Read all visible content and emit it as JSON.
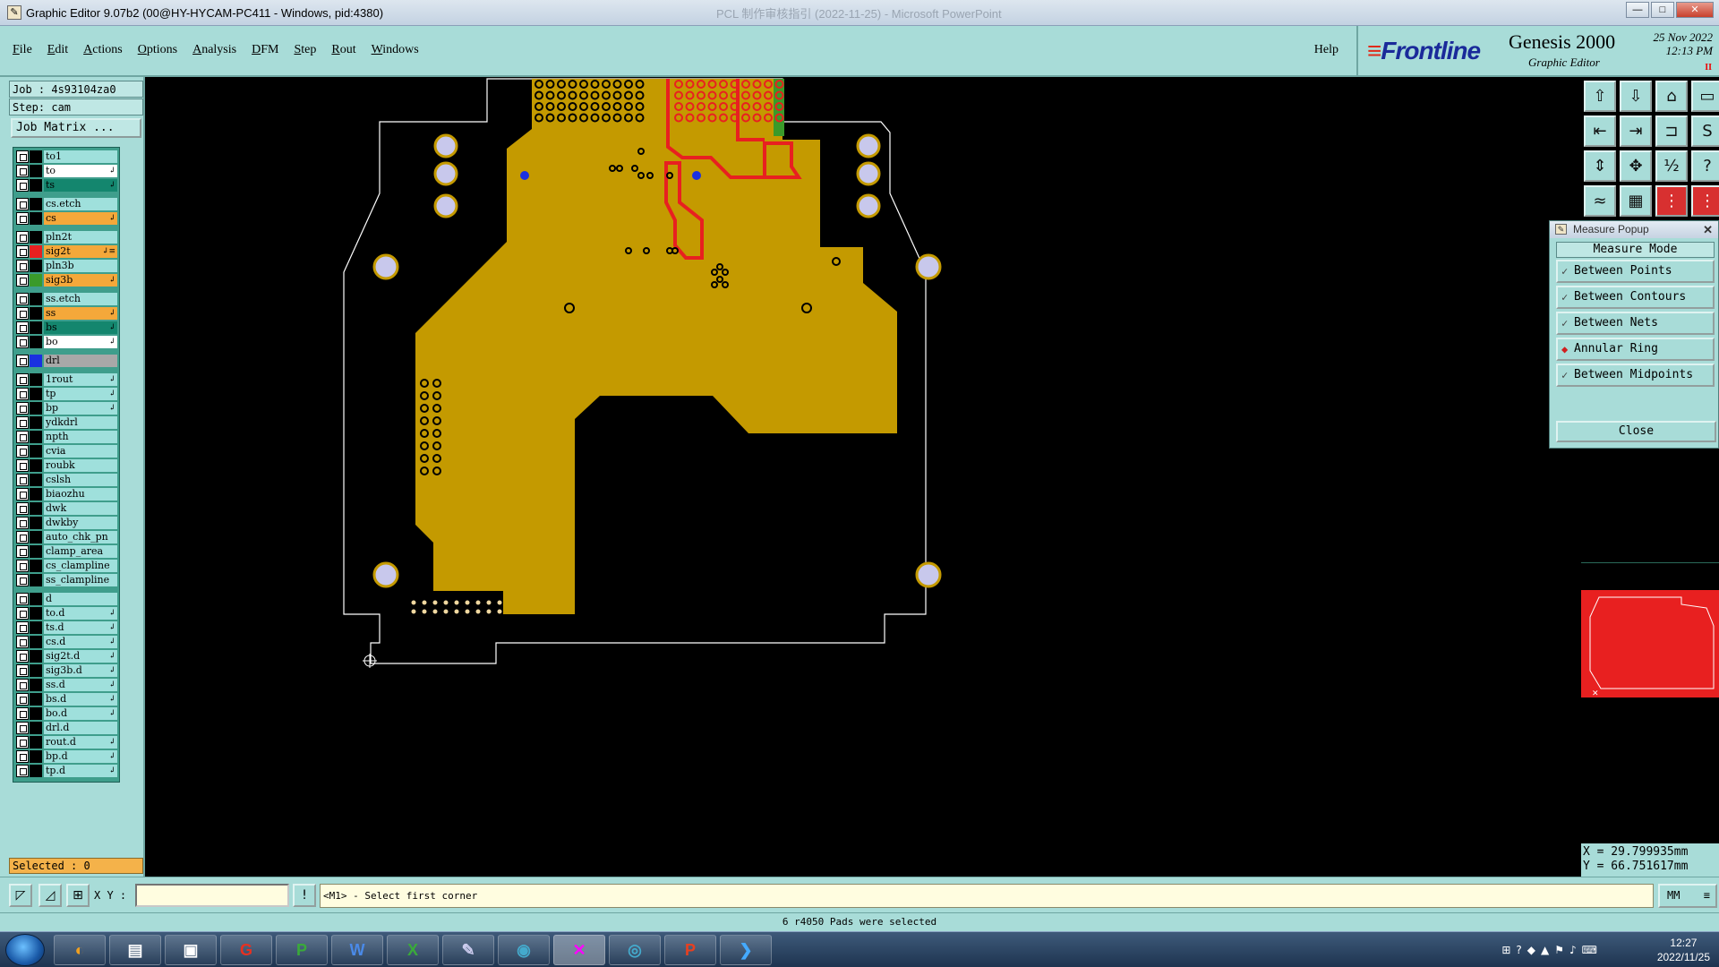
{
  "window": {
    "title": "Graphic Editor 9.07b2 (00@HY-HYCAM-PC411 - Windows, pid:4380)",
    "ghost_title": "PCL 制作审核指引 (2022-11-25) - Microsoft PowerPoint",
    "min_label": "—",
    "max_label": "□",
    "close_label": "✕"
  },
  "menu": {
    "items": [
      "File",
      "Edit",
      "Actions",
      "Options",
      "Analysis",
      "DFM",
      "Step",
      "Rout",
      "Windows"
    ],
    "help": "Help"
  },
  "brand": {
    "logo": "Frontline",
    "product": "Genesis 2000",
    "subtitle": "Graphic Editor",
    "date": "25 Nov 2022",
    "time": "12:13 PM",
    "pause": "II"
  },
  "job": {
    "job_label": "Job : 4s93104za0",
    "step_label": "Step: cam",
    "matrix_button": "Job Matrix ..."
  },
  "layers": [
    {
      "name": "to1",
      "color": "#000000",
      "bg": "#9fe0dc",
      "arrow": ""
    },
    {
      "name": "to",
      "color": "#000000",
      "bg": "#ffffff",
      "arrow": "↲"
    },
    {
      "name": "ts",
      "color": "#000000",
      "bg": "#14866e",
      "arrow": "↲"
    },
    {
      "name": "cs.etch",
      "color": "#000000",
      "bg": "#9fe0dc",
      "arrow": ""
    },
    {
      "name": "cs",
      "color": "#000000",
      "bg": "#f4a83a",
      "arrow": "↲"
    },
    {
      "name": "pln2t",
      "color": "#000000",
      "bg": "#9fe0dc",
      "arrow": ""
    },
    {
      "name": "sig2t",
      "color": "#e82020",
      "bg": "#f4a83a",
      "arrow": "↲≡"
    },
    {
      "name": "pln3b",
      "color": "#000000",
      "bg": "#9fe0dc",
      "arrow": ""
    },
    {
      "name": "sig3b",
      "color": "#3a9a2a",
      "bg": "#f4a83a",
      "arrow": "↲"
    },
    {
      "name": "ss.etch",
      "color": "#000000",
      "bg": "#9fe0dc",
      "arrow": ""
    },
    {
      "name": "ss",
      "color": "#000000",
      "bg": "#f4a83a",
      "arrow": "↲"
    },
    {
      "name": "bs",
      "color": "#000000",
      "bg": "#14866e",
      "arrow": "↲"
    },
    {
      "name": "bo",
      "color": "#000000",
      "bg": "#ffffff",
      "arrow": "↲"
    },
    {
      "name": "drl",
      "color": "#1a30e0",
      "bg": "#a8a8a8",
      "arrow": ""
    },
    {
      "name": "1rout",
      "color": "#000000",
      "bg": "#9fe0dc",
      "arrow": "↲"
    },
    {
      "name": "tp",
      "color": "#000000",
      "bg": "#9fe0dc",
      "arrow": "↲"
    },
    {
      "name": "bp",
      "color": "#000000",
      "bg": "#9fe0dc",
      "arrow": "↲"
    },
    {
      "name": "ydkdrl",
      "color": "#000000",
      "bg": "#9fe0dc",
      "arrow": ""
    },
    {
      "name": "npth",
      "color": "#000000",
      "bg": "#9fe0dc",
      "arrow": ""
    },
    {
      "name": "cvia",
      "color": "#000000",
      "bg": "#9fe0dc",
      "arrow": ""
    },
    {
      "name": "roubk",
      "color": "#000000",
      "bg": "#9fe0dc",
      "arrow": ""
    },
    {
      "name": "cslsh",
      "color": "#000000",
      "bg": "#9fe0dc",
      "arrow": ""
    },
    {
      "name": "biaozhu",
      "color": "#000000",
      "bg": "#9fe0dc",
      "arrow": ""
    },
    {
      "name": "dwk",
      "color": "#000000",
      "bg": "#9fe0dc",
      "arrow": ""
    },
    {
      "name": "dwkby",
      "color": "#000000",
      "bg": "#9fe0dc",
      "arrow": ""
    },
    {
      "name": "auto_chk_pn",
      "color": "#000000",
      "bg": "#9fe0dc",
      "arrow": ""
    },
    {
      "name": "clamp_area",
      "color": "#000000",
      "bg": "#9fe0dc",
      "arrow": ""
    },
    {
      "name": "cs_clampline",
      "color": "#000000",
      "bg": "#9fe0dc",
      "arrow": ""
    },
    {
      "name": "ss_clampline",
      "color": "#000000",
      "bg": "#9fe0dc",
      "arrow": ""
    },
    {
      "name": "d",
      "color": "#000000",
      "bg": "#9fe0dc",
      "arrow": ""
    },
    {
      "name": "to.d",
      "color": "#000000",
      "bg": "#9fe0dc",
      "arrow": "↲"
    },
    {
      "name": "ts.d",
      "color": "#000000",
      "bg": "#9fe0dc",
      "arrow": "↲"
    },
    {
      "name": "cs.d",
      "color": "#000000",
      "bg": "#9fe0dc",
      "arrow": "↲"
    },
    {
      "name": "sig2t.d",
      "color": "#000000",
      "bg": "#9fe0dc",
      "arrow": "↲"
    },
    {
      "name": "sig3b.d",
      "color": "#000000",
      "bg": "#9fe0dc",
      "arrow": "↲"
    },
    {
      "name": "ss.d",
      "color": "#000000",
      "bg": "#9fe0dc",
      "arrow": "↲"
    },
    {
      "name": "bs.d",
      "color": "#000000",
      "bg": "#9fe0dc",
      "arrow": "↲"
    },
    {
      "name": "bo.d",
      "color": "#000000",
      "bg": "#9fe0dc",
      "arrow": "↲"
    },
    {
      "name": "drl.d",
      "color": "#000000",
      "bg": "#9fe0dc",
      "arrow": ""
    },
    {
      "name": "rout.d",
      "color": "#000000",
      "bg": "#9fe0dc",
      "arrow": "↲"
    },
    {
      "name": "bp.d",
      "color": "#000000",
      "bg": "#9fe0dc",
      "arrow": "↲"
    },
    {
      "name": "tp.d",
      "color": "#000000",
      "bg": "#9fe0dc",
      "arrow": "↲"
    }
  ],
  "selected": "Selected : 0",
  "measure_popup": {
    "title": "Measure Popup",
    "header": "Measure Mode",
    "options": [
      {
        "label": "Between Points",
        "active": false
      },
      {
        "label": "Between Contours",
        "active": false
      },
      {
        "label": "Between Nets",
        "active": false
      },
      {
        "label": "Annular Ring",
        "active": true
      },
      {
        "label": "Between Midpoints",
        "active": false
      }
    ],
    "close": "Close"
  },
  "coords": {
    "x": "X = 29.799935mm",
    "y": "Y = 66.751617mm"
  },
  "command": {
    "xy_label": "X Y :",
    "xy_value": "",
    "prompt": "<M1> - Select first corner",
    "unit": "MM"
  },
  "status": "6 r4050 Pads were selected",
  "taskbar": {
    "time": "12:27",
    "date": "2022/11/25"
  },
  "colors": {
    "copper": "#c49a00",
    "highlight": "#e82020",
    "pad": "#c8c8ec",
    "panel": "#a8dcd8"
  }
}
